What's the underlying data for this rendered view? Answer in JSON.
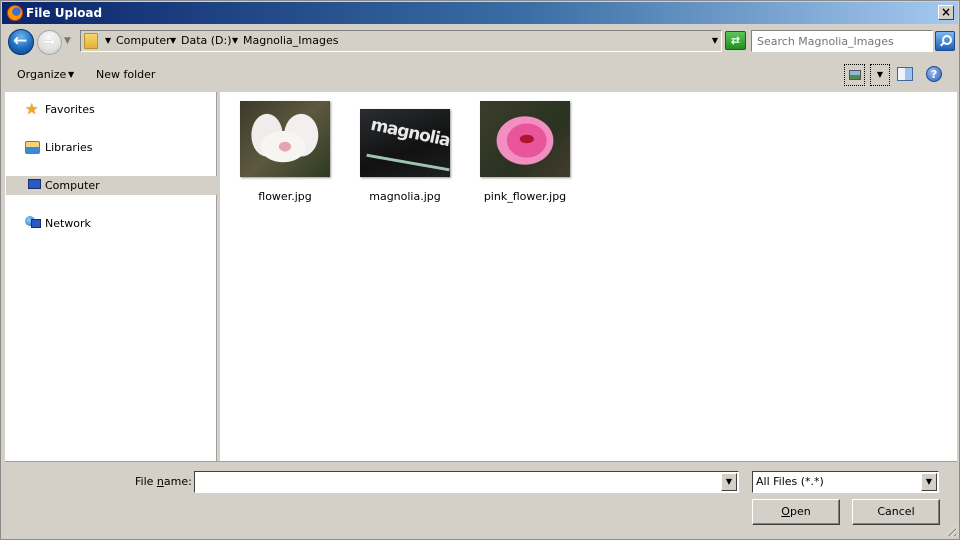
{
  "window": {
    "title": "File Upload",
    "close_label": "×"
  },
  "navbar": {
    "breadcrumbs": [
      "Computer",
      "Data (D:)",
      "Magnolia_Images"
    ],
    "search_placeholder": "Search Magnolia_Images",
    "refresh_glyph": "⇄"
  },
  "toolbar": {
    "organize_label": "Organize",
    "new_folder_label": "New folder",
    "help_label": "?"
  },
  "navpane": {
    "items": [
      {
        "label": "Favorites",
        "icon": "star-icon",
        "selected": false
      },
      {
        "label": "Libraries",
        "icon": "libraries-icon",
        "selected": false
      },
      {
        "label": "Computer",
        "icon": "computer-icon",
        "selected": true
      },
      {
        "label": "Network",
        "icon": "network-icon",
        "selected": false
      }
    ]
  },
  "files": [
    {
      "name": "flower.jpg",
      "thumbnail": "white magnolia flower"
    },
    {
      "name": "magnolia.jpg",
      "thumbnail": "magnolia logo text",
      "thumb_text": "magnolia"
    },
    {
      "name": "pink_flower.jpg",
      "thumbnail": "pink magnolia flower"
    }
  ],
  "bottom": {
    "filename_label_pre": "File ",
    "filename_label_accel": "n",
    "filename_label_post": "ame:",
    "filename_value": "",
    "filter_value": "All Files (*.*)",
    "open_accel": "O",
    "open_rest": "pen",
    "cancel_label": "Cancel"
  },
  "glyphs": {
    "dropdown": "▼"
  }
}
